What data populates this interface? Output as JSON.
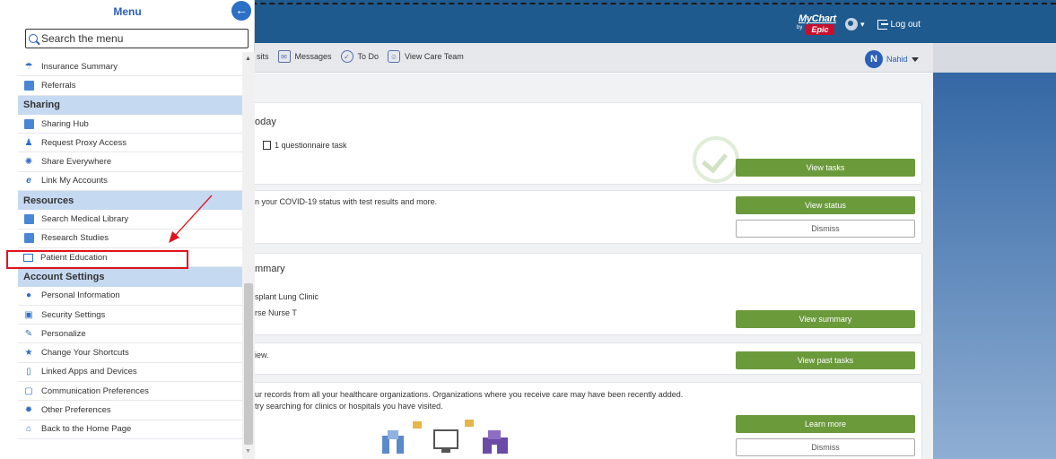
{
  "header": {
    "logo_my": "MyChart",
    "logo_by": "by",
    "logo_epic": "Epic",
    "logout_label": "Log out",
    "lang_caret": "▾"
  },
  "nav": {
    "items": [
      {
        "label": "sits",
        "icon": "visits-icon"
      },
      {
        "label": "Messages",
        "icon": "envelope-icon"
      },
      {
        "label": "To Do",
        "icon": "checkmark-icon"
      },
      {
        "label": "View Care Team",
        "icon": "care-team-icon"
      }
    ],
    "user_initial": "N",
    "user_name": "Nahid"
  },
  "menu": {
    "title": "Menu",
    "search_placeholder": "Search the menu",
    "items": [
      {
        "type": "item",
        "label": "Insurance Summary",
        "icon": "umbrella-icon"
      },
      {
        "type": "item",
        "label": "Referrals",
        "icon": "referral-icon"
      },
      {
        "type": "header",
        "label": "Sharing"
      },
      {
        "type": "item",
        "label": "Sharing Hub",
        "icon": "folder-share-icon"
      },
      {
        "type": "item",
        "label": "Request Proxy Access",
        "icon": "add-person-icon"
      },
      {
        "type": "item",
        "label": "Share Everywhere",
        "icon": "share-everywhere-icon"
      },
      {
        "type": "item",
        "label": "Link My Accounts",
        "icon": "link-icon"
      },
      {
        "type": "header",
        "label": "Resources"
      },
      {
        "type": "item",
        "label": "Search Medical Library",
        "icon": "library-icon"
      },
      {
        "type": "item",
        "label": "Research Studies",
        "icon": "research-icon"
      },
      {
        "type": "item",
        "label": "Patient Education",
        "icon": "book-icon"
      },
      {
        "type": "header",
        "label": "Account Settings"
      },
      {
        "type": "item",
        "label": "Personal Information",
        "icon": "person-icon"
      },
      {
        "type": "item",
        "label": "Security Settings",
        "icon": "lock-icon"
      },
      {
        "type": "item",
        "label": "Personalize",
        "icon": "brush-icon"
      },
      {
        "type": "item",
        "label": "Change Your Shortcuts",
        "icon": "star-icon"
      },
      {
        "type": "item",
        "label": "Linked Apps and Devices",
        "icon": "device-icon"
      },
      {
        "type": "item",
        "label": "Communication Preferences",
        "icon": "communication-icon"
      },
      {
        "type": "item",
        "label": "Other Preferences",
        "icon": "gear-icon"
      },
      {
        "type": "item",
        "label": "Back to the Home Page",
        "icon": "home-icon"
      }
    ]
  },
  "cards": {
    "todo_title": "oday",
    "todo_task": "1 questionnaire task",
    "todo_btn": "View tasks",
    "covid_text": "n your COVID-19 status with test results and more.",
    "covid_btn": "View status",
    "covid_dismiss": "Dismiss",
    "summary_title": "mmary",
    "summary_line1": "splant Lung Clinic",
    "summary_line2": "rse Nurse T",
    "summary_btn": "View summary",
    "past_text": "iew.",
    "past_btn": "View past tasks",
    "records_line1": "ur records from all your healthcare organizations. Organizations where you receive care may have been recently added.",
    "records_line2": "try searching for clinics or hospitals you have visited.",
    "records_btn": "Learn more",
    "records_dismiss": "Dismiss"
  },
  "colors": {
    "header_blue": "#1f5a8e",
    "accent_green": "#6b9a3b",
    "menu_header_bg": "#c5d9f1",
    "annotation_red": "#e0141e"
  }
}
